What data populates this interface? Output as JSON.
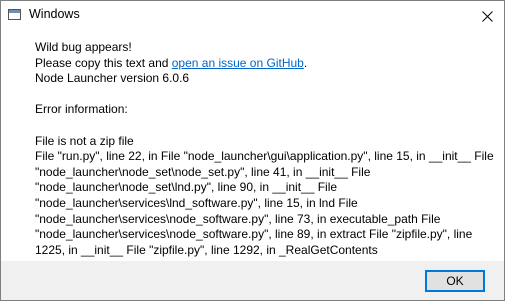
{
  "window": {
    "title": "Windows",
    "icon": "window-app-icon",
    "close_icon": "close-icon"
  },
  "message": {
    "intro": "Wild bug appears!",
    "copy_prefix": "Please copy this text and ",
    "copy_link": "open an issue on GitHub",
    "copy_suffix": ".",
    "version": "Node Launcher version 6.0.6",
    "error_heading": "Error information:",
    "error_title": "File is not a zip file",
    "traceback": "File \"run.py\", line 22, in File \"node_launcher\\gui\\application.py\", line 15, in __init__ File \"node_launcher\\node_set\\node_set.py\", line 41, in __init__ File \"node_launcher\\node_set\\lnd.py\", line 90, in __init__ File \"node_launcher\\services\\lnd_software.py\", line 15, in lnd File \"node_launcher\\services\\node_software.py\", line 73, in executable_path File \"node_launcher\\services\\node_software.py\", line 89, in extract File \"zipfile.py\", line 1225, in __init__ File \"zipfile.py\", line 1292, in _RealGetContents"
  },
  "footer": {
    "ok_label": "OK"
  },
  "colors": {
    "link": "#0066cc",
    "button_border": "#0078d7",
    "footer_bg": "#f0f0f0"
  }
}
